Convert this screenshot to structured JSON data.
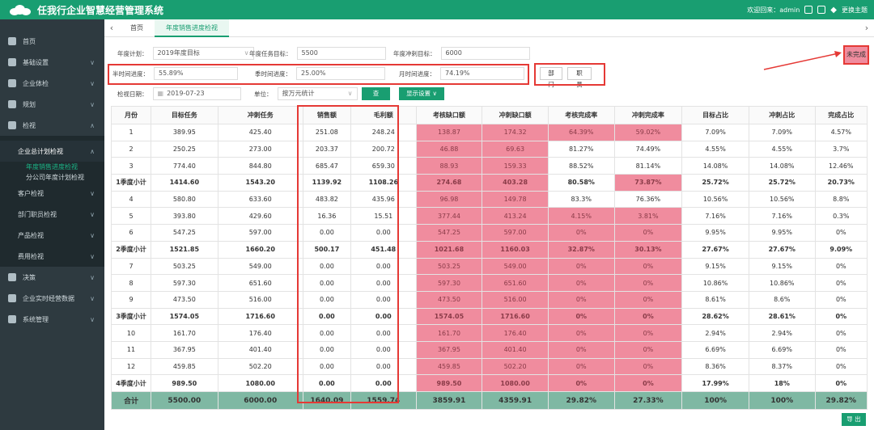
{
  "header": {
    "title": "任我行企业智慧经营管理系统",
    "welcome": "欢迎回来：admin",
    "theme": "更换主题"
  },
  "sidebar": {
    "items": [
      {
        "label": "首页",
        "expand": false
      },
      {
        "label": "基础设置",
        "expand": true
      },
      {
        "label": "企业体检",
        "expand": true
      },
      {
        "label": "规划",
        "expand": true
      },
      {
        "label": "检视",
        "expand": true
      }
    ],
    "group": {
      "label": "企业总计划检视",
      "leaves": [
        "年度销售进度检视",
        "分公司年度计划检视"
      ]
    },
    "sub_items": [
      "客户检视",
      "部门职员检视",
      "产品检视",
      "费用检视"
    ],
    "bottom_items": [
      "决策",
      "企业实时经营数据",
      "系统管理"
    ]
  },
  "tabs": [
    {
      "label": "首页"
    },
    {
      "label": "年度销售进度检视"
    }
  ],
  "filters": {
    "plan_label": "年度计划：",
    "plan_value": "2019年度目标",
    "target_label": "年度任务目标：",
    "target_value": "5500",
    "sprint_label": "年度冲刺目标：",
    "sprint_value": "6000",
    "half_label": "半时间进度：",
    "half_value": "55.89%",
    "quarter_label": "季时间进度：",
    "quarter_value": "25.00%",
    "month_label": "月时间进度：",
    "month_value": "74.19%",
    "dept_btn": "部门",
    "staff_btn": "职员",
    "date_label": "检视日期：",
    "date_value": "2019-07-23",
    "unit_label": "单位：",
    "unit_value": "按万元统计",
    "query_btn": "查 询",
    "display_btn": "显示设置 ∨"
  },
  "status_badge": "未完成",
  "export_btn": "导 出",
  "table": {
    "headers": [
      "月份",
      "目标任务",
      "冲刺任务",
      "销售额",
      "毛利额",
      "考核缺口额",
      "冲刺缺口额",
      "考核完成率",
      "冲刺完成率",
      "目标占比",
      "冲刺占比",
      "完成占比"
    ],
    "rows": [
      {
        "c": [
          "1",
          "389.95",
          "425.40",
          "251.08",
          "248.24",
          "138.87",
          "174.32",
          "64.39%",
          "59.02%",
          "7.09%",
          "7.09%",
          "4.57%"
        ],
        "t": "n",
        "pk": [
          5,
          6,
          7,
          8
        ]
      },
      {
        "c": [
          "2",
          "250.25",
          "273.00",
          "203.37",
          "200.72",
          "46.88",
          "69.63",
          "81.27%",
          "74.49%",
          "4.55%",
          "4.55%",
          "3.7%"
        ],
        "t": "n",
        "pk": [
          5,
          6
        ]
      },
      {
        "c": [
          "3",
          "774.40",
          "844.80",
          "685.47",
          "659.30",
          "88.93",
          "159.33",
          "88.52%",
          "81.14%",
          "14.08%",
          "14.08%",
          "12.46%"
        ],
        "t": "n",
        "pk": [
          5,
          6
        ]
      },
      {
        "c": [
          "1季度小计",
          "1414.60",
          "1543.20",
          "1139.92",
          "1108.26",
          "274.68",
          "403.28",
          "80.58%",
          "73.87%",
          "25.72%",
          "25.72%",
          "20.73%"
        ],
        "t": "s",
        "pk": [
          5,
          6,
          8
        ]
      },
      {
        "c": [
          "4",
          "580.80",
          "633.60",
          "483.82",
          "435.96",
          "96.98",
          "149.78",
          "83.3%",
          "76.36%",
          "10.56%",
          "10.56%",
          "8.8%"
        ],
        "t": "n",
        "pk": [
          5,
          6
        ]
      },
      {
        "c": [
          "5",
          "393.80",
          "429.60",
          "16.36",
          "15.51",
          "377.44",
          "413.24",
          "4.15%",
          "3.81%",
          "7.16%",
          "7.16%",
          "0.3%"
        ],
        "t": "n",
        "pk": [
          5,
          6,
          7,
          8
        ]
      },
      {
        "c": [
          "6",
          "547.25",
          "597.00",
          "0.00",
          "0.00",
          "547.25",
          "597.00",
          "0%",
          "0%",
          "9.95%",
          "9.95%",
          "0%"
        ],
        "t": "n",
        "pk": [
          5,
          6,
          7,
          8
        ]
      },
      {
        "c": [
          "2季度小计",
          "1521.85",
          "1660.20",
          "500.17",
          "451.48",
          "1021.68",
          "1160.03",
          "32.87%",
          "30.13%",
          "27.67%",
          "27.67%",
          "9.09%"
        ],
        "t": "s",
        "pk": [
          5,
          6,
          7,
          8
        ]
      },
      {
        "c": [
          "7",
          "503.25",
          "549.00",
          "0.00",
          "0.00",
          "503.25",
          "549.00",
          "0%",
          "0%",
          "9.15%",
          "9.15%",
          "0%"
        ],
        "t": "n",
        "pk": [
          5,
          6,
          7,
          8
        ]
      },
      {
        "c": [
          "8",
          "597.30",
          "651.60",
          "0.00",
          "0.00",
          "597.30",
          "651.60",
          "0%",
          "0%",
          "10.86%",
          "10.86%",
          "0%"
        ],
        "t": "n",
        "pk": [
          5,
          6,
          7,
          8
        ]
      },
      {
        "c": [
          "9",
          "473.50",
          "516.00",
          "0.00",
          "0.00",
          "473.50",
          "516.00",
          "0%",
          "0%",
          "8.61%",
          "8.6%",
          "0%"
        ],
        "t": "n",
        "pk": [
          5,
          6,
          7,
          8
        ]
      },
      {
        "c": [
          "3季度小计",
          "1574.05",
          "1716.60",
          "0.00",
          "0.00",
          "1574.05",
          "1716.60",
          "0%",
          "0%",
          "28.62%",
          "28.61%",
          "0%"
        ],
        "t": "s",
        "pk": [
          5,
          6,
          7,
          8
        ]
      },
      {
        "c": [
          "10",
          "161.70",
          "176.40",
          "0.00",
          "0.00",
          "161.70",
          "176.40",
          "0%",
          "0%",
          "2.94%",
          "2.94%",
          "0%"
        ],
        "t": "n",
        "pk": [
          5,
          6,
          7,
          8
        ]
      },
      {
        "c": [
          "11",
          "367.95",
          "401.40",
          "0.00",
          "0.00",
          "367.95",
          "401.40",
          "0%",
          "0%",
          "6.69%",
          "6.69%",
          "0%"
        ],
        "t": "n",
        "pk": [
          5,
          6,
          7,
          8
        ]
      },
      {
        "c": [
          "12",
          "459.85",
          "502.20",
          "0.00",
          "0.00",
          "459.85",
          "502.20",
          "0%",
          "0%",
          "8.36%",
          "8.37%",
          "0%"
        ],
        "t": "n",
        "pk": [
          5,
          6,
          7,
          8
        ]
      },
      {
        "c": [
          "4季度小计",
          "989.50",
          "1080.00",
          "0.00",
          "0.00",
          "989.50",
          "1080.00",
          "0%",
          "0%",
          "17.99%",
          "18%",
          "0%"
        ],
        "t": "s",
        "pk": [
          5,
          6,
          7,
          8
        ]
      }
    ],
    "total": [
      "合计",
      "5500.00",
      "6000.00",
      "1640.09",
      "1559.74",
      "3859.91",
      "4359.91",
      "29.82%",
      "27.33%",
      "100%",
      "100%",
      "29.82%"
    ]
  },
  "colors": {
    "brand": "#199e71",
    "sidebar": "#2e3a40",
    "pink": "#f08c9e",
    "total_row": "#7fb8a3",
    "highlight": "#e53935"
  }
}
